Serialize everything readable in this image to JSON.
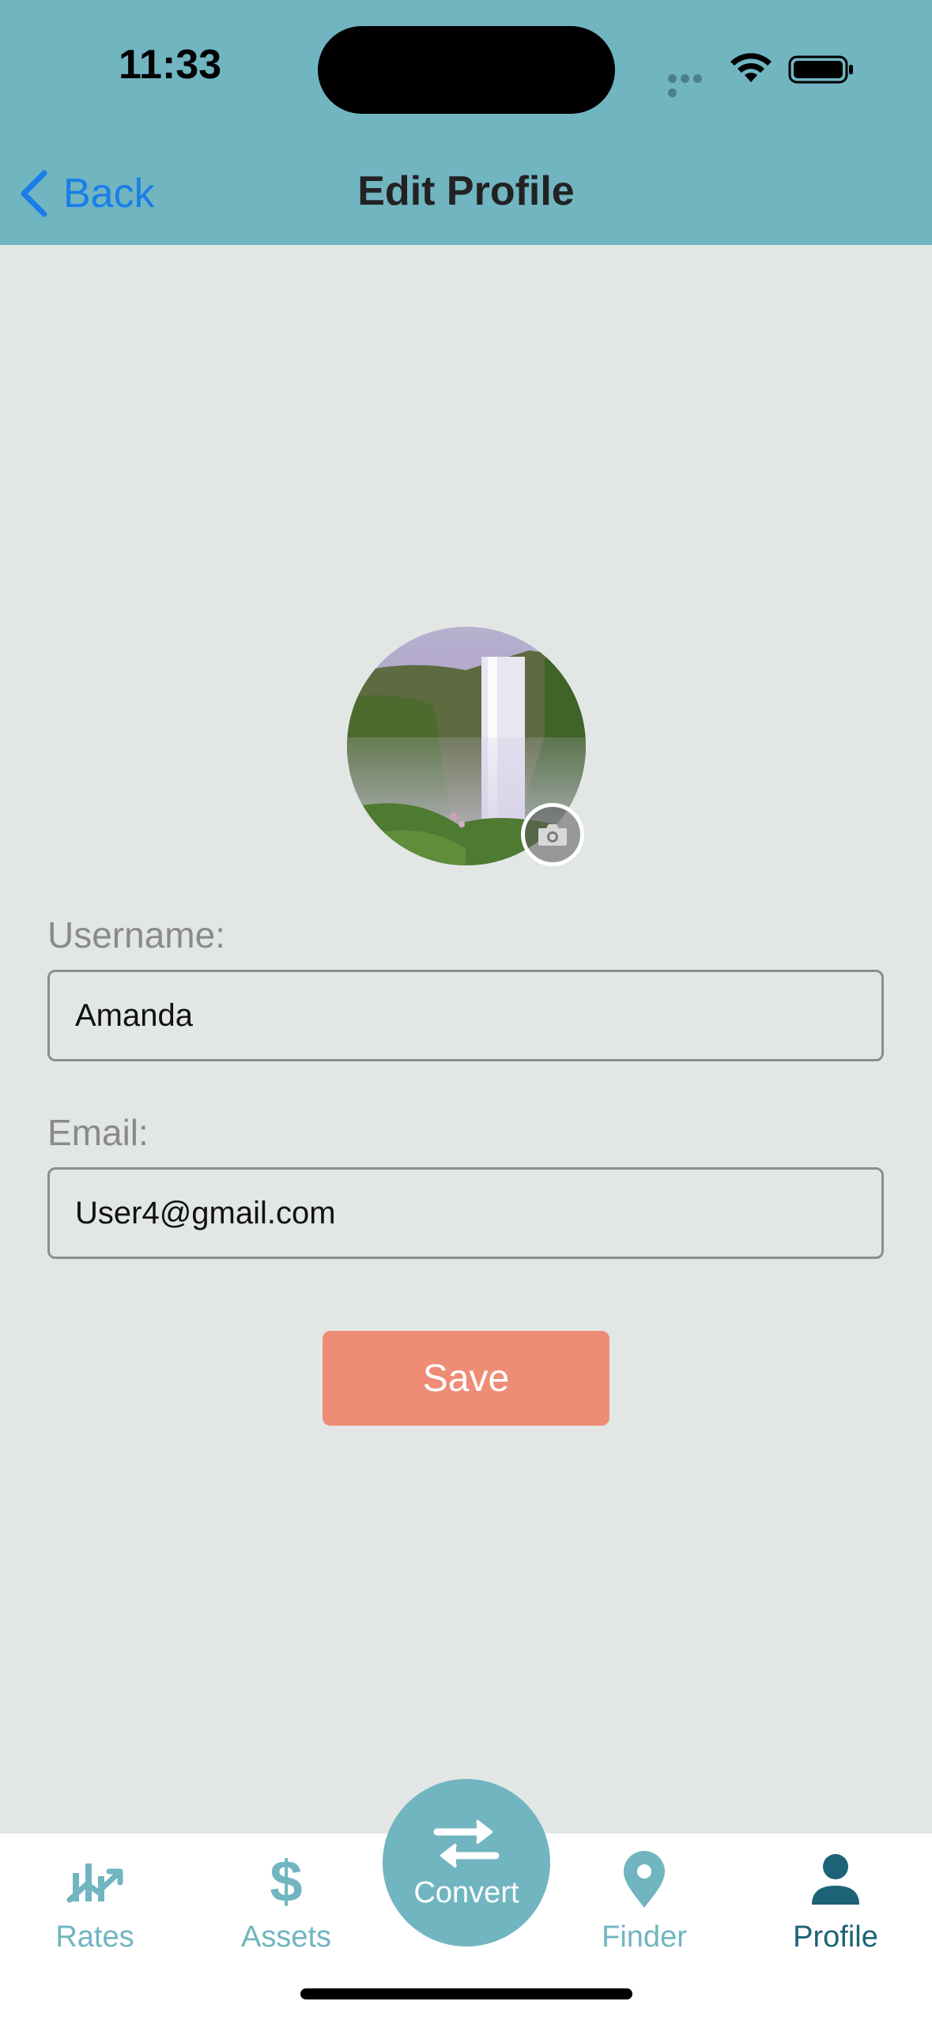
{
  "status_bar": {
    "time": "11:33"
  },
  "nav": {
    "back_label": "Back",
    "title": "Edit Profile"
  },
  "form": {
    "username_label": "Username:",
    "username_value": "Amanda",
    "email_label": "Email:",
    "email_value": "User4@gmail.com",
    "save_label": "Save"
  },
  "tabs": [
    {
      "label": "Rates",
      "icon": "chart-trend-icon"
    },
    {
      "label": "Assets",
      "icon": "dollar-icon"
    },
    {
      "label": "Convert",
      "icon": "swap-arrows-icon"
    },
    {
      "label": "Finder",
      "icon": "map-pin-icon"
    },
    {
      "label": "Profile",
      "icon": "person-icon",
      "active": true
    }
  ],
  "colors": {
    "header": "#71b5c1",
    "background": "#e2e7e5",
    "accent_link": "#1a7ee8",
    "save_button": "#ee8c76",
    "active_tab": "#1d6377"
  }
}
